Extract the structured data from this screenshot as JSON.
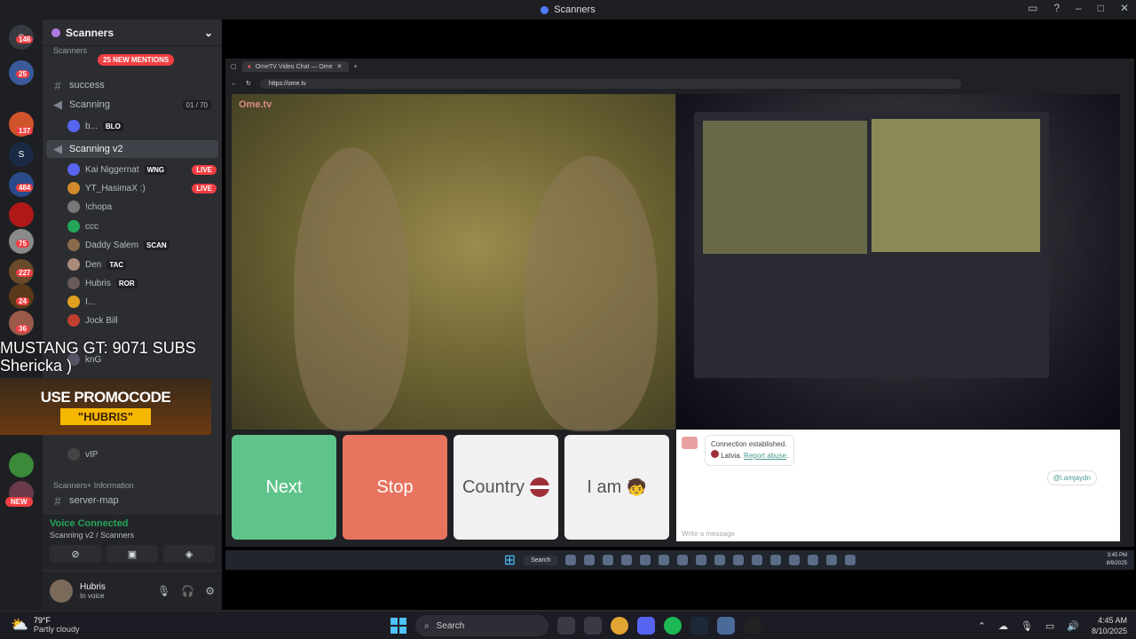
{
  "window": {
    "title": "Scanners"
  },
  "guild_badges": [
    "146",
    "25",
    "137",
    "484",
    "75",
    "227",
    "24",
    "36",
    "NEW"
  ],
  "server": {
    "name": "Scanners",
    "category_top": "Scanners",
    "mentions": "25 NEW MENTIONS"
  },
  "channels": [
    {
      "name": "success"
    },
    {
      "name": "Scanning",
      "count_a": "01",
      "count_b": "70"
    },
    {
      "name": "Scanning v2"
    }
  ],
  "voice_users": [
    {
      "name": "b...",
      "tag": "BLO"
    },
    {
      "name": "Kai Niggernat",
      "tag": "WNG",
      "live": "LIVE"
    },
    {
      "name": "YT_HasimaX :)",
      "live": "LIVE"
    },
    {
      "name": "!chopa"
    },
    {
      "name": "ccc"
    },
    {
      "name": "Daddy Salem",
      "tag": "SCAN"
    },
    {
      "name": "Den",
      "tag": "TAC"
    },
    {
      "name": "Hubris",
      "tag": "ROR"
    },
    {
      "name": "I..."
    },
    {
      "name": "Jock Bill"
    },
    {
      "name": "knG"
    },
    {
      "name": "vIP"
    }
  ],
  "overlay": {
    "line1": "MUSTANG GT: 9071 SUBS",
    "line2": "Shericka )",
    "promo_top": "USE PROMOCODE",
    "promo_code": "\"HUBRIS\""
  },
  "info_category": "Scanners+ Information",
  "info_channel": "server-map",
  "voice": {
    "status": "Voice Connected",
    "location": "Scanning v2 / Scanners"
  },
  "user": {
    "name": "Hubris",
    "status": "In voice"
  },
  "browser": {
    "tab": "OmeTV Video Chat — Ome",
    "url": "https://ome.tv"
  },
  "ome": {
    "logo": "Ome.tv",
    "next": "Next",
    "stop": "Stop",
    "country": "Country",
    "iam": "I am",
    "msg1": "Connection established.",
    "msg_country": "Latvia.",
    "msg_report": "Report abuse",
    "my_handle": "@i.amjaydn",
    "placeholder": "Write a message"
  },
  "inner_taskbar": {
    "search": "Search",
    "time": "3:45 PM",
    "date": "8/9/2025"
  },
  "taskbar": {
    "temp": "79°F",
    "weather": "Partly cloudy",
    "search": "Search",
    "time": "4:45 AM",
    "date": "8/10/2025"
  },
  "colors": {
    "next": "#5fc48a",
    "stop": "#e8735e",
    "live": "#f23f43",
    "voice_connected": "#23a55a"
  }
}
